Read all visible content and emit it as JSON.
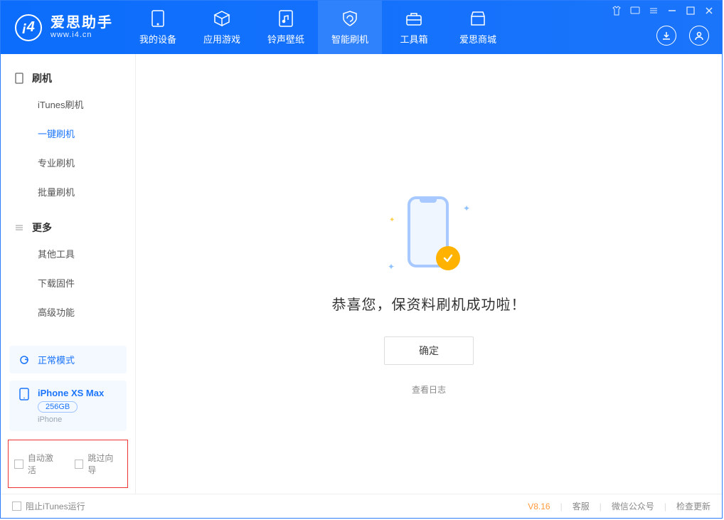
{
  "app": {
    "title": "爱思助手",
    "subtitle": "www.i4.cn"
  },
  "tabs": {
    "device": "我的设备",
    "apps": "应用游戏",
    "ring": "铃声壁纸",
    "flash": "智能刷机",
    "tools": "工具箱",
    "store": "爱思商城"
  },
  "sidebar": {
    "section_flash": "刷机",
    "items_flash": {
      "itunes": "iTunes刷机",
      "onekey": "一键刷机",
      "pro": "专业刷机",
      "batch": "批量刷机"
    },
    "section_more": "更多",
    "items_more": {
      "other": "其他工具",
      "firmware": "下载固件",
      "advanced": "高级功能"
    }
  },
  "device_status": {
    "mode": "正常模式"
  },
  "device": {
    "name": "iPhone XS Max",
    "storage": "256GB",
    "type": "iPhone"
  },
  "options": {
    "auto_activate": "自动激活",
    "skip_guide": "跳过向导"
  },
  "main": {
    "success": "恭喜您，保资料刷机成功啦！",
    "ok": "确定",
    "view_log": "查看日志"
  },
  "footer": {
    "block_itunes": "阻止iTunes运行",
    "version": "V8.16",
    "service": "客服",
    "wechat": "微信公众号",
    "update": "检查更新"
  }
}
